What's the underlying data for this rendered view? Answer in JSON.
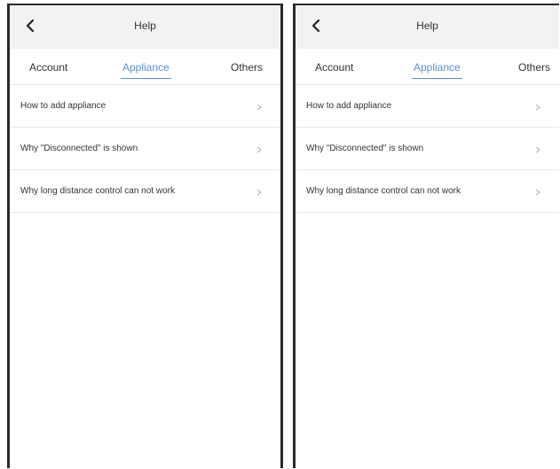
{
  "screens": [
    {
      "header": {
        "title": "Help",
        "back_icon": "chevron-left-icon"
      },
      "tabs": [
        {
          "label": "Account",
          "active": false
        },
        {
          "label": "Appliance",
          "active": true
        },
        {
          "label": "Others",
          "active": false
        }
      ],
      "items": [
        {
          "label": "How to add appliance"
        },
        {
          "label": "Why \"Disconnected\" is shown"
        },
        {
          "label": "Why long distance control can not work"
        }
      ]
    },
    {
      "header": {
        "title": "Help",
        "back_icon": "chevron-left-icon"
      },
      "tabs": [
        {
          "label": "Account",
          "active": false
        },
        {
          "label": "Appliance",
          "active": true
        },
        {
          "label": "Others",
          "active": false
        }
      ],
      "items": [
        {
          "label": "How to add appliance"
        },
        {
          "label": "Why \"Disconnected\" is shown"
        },
        {
          "label": "Why long distance control can not work"
        }
      ]
    }
  ],
  "colors": {
    "accent": "#5b8fd6",
    "header_bg": "#f2f2f2",
    "divider": "#e8e8e8",
    "frame": "#2a2a2a"
  }
}
